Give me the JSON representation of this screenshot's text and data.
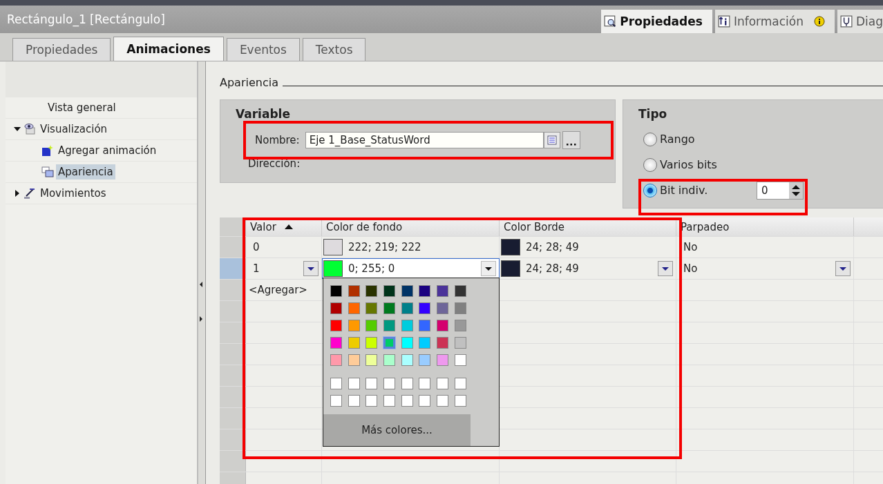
{
  "title_bar": {
    "title": "Rectángulo_1 [Rectángulo]",
    "tabs": [
      {
        "label": "Propiedades",
        "kind": "properties",
        "selected": true
      },
      {
        "label": "Información",
        "kind": "info",
        "selected": false
      },
      {
        "label": "Diag",
        "kind": "diag",
        "selected": false
      }
    ]
  },
  "tabs": [
    {
      "label": "Propiedades",
      "selected": false
    },
    {
      "label": "Animaciones",
      "selected": true
    },
    {
      "label": "Eventos",
      "selected": false
    },
    {
      "label": "Textos",
      "selected": false
    }
  ],
  "tree": [
    {
      "label": "Vista general",
      "kind": "none",
      "selected": false
    },
    {
      "label": "Visualización",
      "kind": "display",
      "selected": false,
      "expanded": true,
      "children": [
        {
          "label": "Agregar animación",
          "kind": "add",
          "selected": false
        },
        {
          "label": "Apariencia",
          "kind": "appearance",
          "selected": true
        }
      ]
    },
    {
      "label": "Movimientos",
      "kind": "motion",
      "selected": false,
      "expanded": false
    }
  ],
  "section_title": "Apariencia",
  "variable": {
    "title": "Variable",
    "highlighted": true,
    "name_label": "Nombre:",
    "name_value": "Eje 1_Base_StatusWord",
    "address_label": "Dirección:"
  },
  "type": {
    "title": "Tipo",
    "highlighted": true,
    "bit_value": "0",
    "options": [
      {
        "label": "Rango",
        "selected": false
      },
      {
        "label": "Varios bits",
        "selected": false
      },
      {
        "label": "Bit indiv.",
        "selected": true
      }
    ]
  },
  "table": {
    "highlighted": true,
    "columns": [
      {
        "label": "Valor",
        "sorted": true
      },
      {
        "label": "Color de fondo",
        "sorted": false
      },
      {
        "label": "Color Borde",
        "sorted": false
      },
      {
        "label": "Parpadeo",
        "sorted": false
      }
    ],
    "rows": [
      {
        "value": "0",
        "background": {
          "text": "222; 219; 222",
          "color": "#dedbde"
        },
        "border": {
          "text": "24; 28; 49",
          "color": "#181c31"
        },
        "blink": "No",
        "selected": false
      },
      {
        "value": "1",
        "background": {
          "text": "0; 255; 0",
          "color": "#00ff33"
        },
        "border": {
          "text": "24; 28; 49",
          "color": "#181c31"
        },
        "blink": "No",
        "selected": true
      }
    ],
    "add_label": "<Agregar>"
  },
  "color_picker": {
    "more_button": "Más colores...",
    "swatches": [
      {
        "color": "#000000",
        "selected": false
      },
      {
        "color": "#b03000",
        "selected": false
      },
      {
        "color": "#2a3300",
        "selected": false
      },
      {
        "color": "#00331a",
        "selected": false
      },
      {
        "color": "#003366",
        "selected": false
      },
      {
        "color": "#1a0080",
        "selected": false
      },
      {
        "color": "#4b3399",
        "selected": false
      },
      {
        "color": "#333333",
        "selected": false
      },
      {
        "color": "#b00000",
        "selected": false
      },
      {
        "color": "#ff6600",
        "selected": false
      },
      {
        "color": "#667700",
        "selected": false
      },
      {
        "color": "#007a1f",
        "selected": false
      },
      {
        "color": "#00808a",
        "selected": false
      },
      {
        "color": "#3300ff",
        "selected": false
      },
      {
        "color": "#6e6699",
        "selected": false
      },
      {
        "color": "#808080",
        "selected": false
      },
      {
        "color": "#ff0000",
        "selected": false
      },
      {
        "color": "#ff9900",
        "selected": false
      },
      {
        "color": "#55cc00",
        "selected": false
      },
      {
        "color": "#009980",
        "selected": false
      },
      {
        "color": "#00ccdd",
        "selected": false
      },
      {
        "color": "#3366ff",
        "selected": false
      },
      {
        "color": "#d4006e",
        "selected": false
      },
      {
        "color": "#999999",
        "selected": false
      },
      {
        "color": "#ff00cc",
        "selected": false
      },
      {
        "color": "#eecc00",
        "selected": false
      },
      {
        "color": "#ccff00",
        "selected": false
      },
      {
        "color": "#00cc66",
        "selected": true
      },
      {
        "color": "#00ffff",
        "selected": false
      },
      {
        "color": "#00ccff",
        "selected": false
      },
      {
        "color": "#cc3355",
        "selected": false
      },
      {
        "color": "#c0c0c0",
        "selected": false
      },
      {
        "color": "#ff99aa",
        "selected": false
      },
      {
        "color": "#ffcc99",
        "selected": false
      },
      {
        "color": "#eeff99",
        "selected": false
      },
      {
        "color": "#aaffcc",
        "selected": false
      },
      {
        "color": "#aaffff",
        "selected": false
      },
      {
        "color": "#99ccff",
        "selected": false
      },
      {
        "color": "#ee99ee",
        "selected": false
      },
      {
        "color": "#ffffff",
        "selected": false
      }
    ],
    "custom_swatches": [
      {
        "color": "#ffffff",
        "selected": false
      },
      {
        "color": "#ffffff",
        "selected": false
      },
      {
        "color": "#ffffff",
        "selected": false
      },
      {
        "color": "#ffffff",
        "selected": false
      },
      {
        "color": "#ffffff",
        "selected": false
      },
      {
        "color": "#ffffff",
        "selected": false
      },
      {
        "color": "#ffffff",
        "selected": false
      },
      {
        "color": "#ffffff",
        "selected": false
      },
      {
        "color": "#ffffff",
        "selected": false
      },
      {
        "color": "#ffffff",
        "selected": false
      },
      {
        "color": "#ffffff",
        "selected": false
      },
      {
        "color": "#ffffff",
        "selected": false
      },
      {
        "color": "#ffffff",
        "selected": false
      },
      {
        "color": "#ffffff",
        "selected": false
      },
      {
        "color": "#ffffff",
        "selected": false
      },
      {
        "color": "#ffffff",
        "selected": false
      }
    ]
  }
}
